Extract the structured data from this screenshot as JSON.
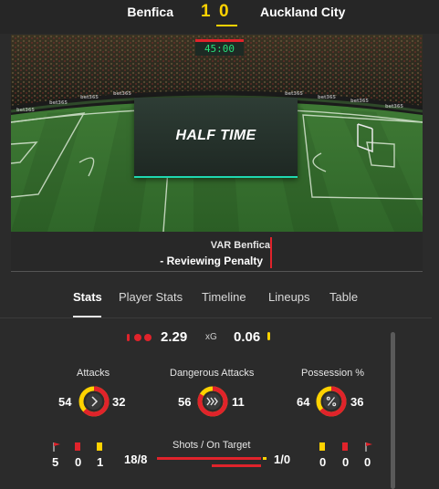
{
  "match": {
    "home_team": "Benfica",
    "away_team": "Auckland City",
    "home_score": "1",
    "away_score": "0",
    "clock": "45:00",
    "status": "HALF TIME",
    "var_line1": "VAR Benfica",
    "var_line2": "- Reviewing Penalty"
  },
  "tabs": [
    {
      "label": "Stats",
      "active": true
    },
    {
      "label": "Player Stats",
      "active": false
    },
    {
      "label": "Timeline",
      "active": false
    },
    {
      "label": "Lineups",
      "active": false
    },
    {
      "label": "Table",
      "active": false
    }
  ],
  "stats": {
    "xg": {
      "label": "xG",
      "home": "2.29",
      "away": "0.06"
    },
    "attacks": {
      "label": "Attacks",
      "home": "54",
      "away": "32",
      "home_value": 54,
      "away_value": 32
    },
    "dangerous_attacks": {
      "label": "Dangerous Attacks",
      "home": "56",
      "away": "11",
      "home_value": 56,
      "away_value": 11
    },
    "possession": {
      "label": "Possession %",
      "home": "64",
      "away": "36",
      "home_value": 64,
      "away_value": 36
    },
    "corners": {
      "home": "5",
      "away": "0"
    },
    "red_cards": {
      "home": "0",
      "away": "0"
    },
    "yellow_cards": {
      "home": "1",
      "away": "0"
    },
    "shots": {
      "label": "Shots / On Target",
      "home": "18/8",
      "away": "1/0",
      "home_total": 18,
      "home_on": 8,
      "away_total": 1,
      "away_on": 0
    }
  },
  "colors": {
    "home": "#e0232b",
    "away": "#ffd200",
    "clock_text": "#28e07b",
    "accent": "#1fd8b0"
  },
  "icons": [
    "corner-flag-icon",
    "red-card-icon",
    "yellow-card-icon",
    "chevron-right-icon",
    "double-chevron-icon",
    "percent-icon"
  ]
}
